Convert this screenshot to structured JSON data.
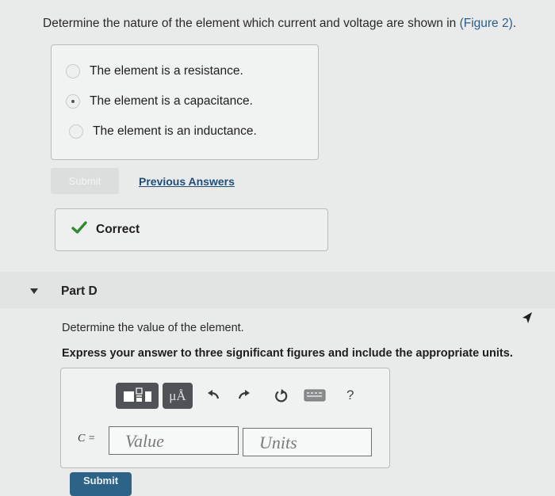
{
  "question": {
    "text_before": "Determine the nature of the element which current and voltage are shown in ",
    "figure_link": "(Figure 2)",
    "text_after": "."
  },
  "choices": [
    {
      "label": "The element is a resistance.",
      "selected": false
    },
    {
      "label": "The element is a capacitance.",
      "selected": true
    },
    {
      "label": "The element is an inductance.",
      "selected": false
    }
  ],
  "actions": {
    "submit_label": "Submit",
    "previous_answers_label": "Previous Answers"
  },
  "feedback": {
    "label": "Correct",
    "icon": "checkmark-icon",
    "color": "#2f8a2f"
  },
  "part_d": {
    "label": "Part D",
    "instruction": "Determine the value of the element.",
    "instruction_bold": "Express your answer to three significant figures and include the appropriate units."
  },
  "toolbar": {
    "units_label": "μÅ",
    "help_label": "?",
    "icons": [
      "templates-icon",
      "units-icon",
      "undo-icon",
      "redo-icon",
      "reset-icon",
      "keyboard-icon",
      "help-icon"
    ]
  },
  "answer": {
    "variable_label": "C =",
    "value_placeholder": "Value",
    "units_placeholder": "Units",
    "submit_label": "Submit"
  }
}
